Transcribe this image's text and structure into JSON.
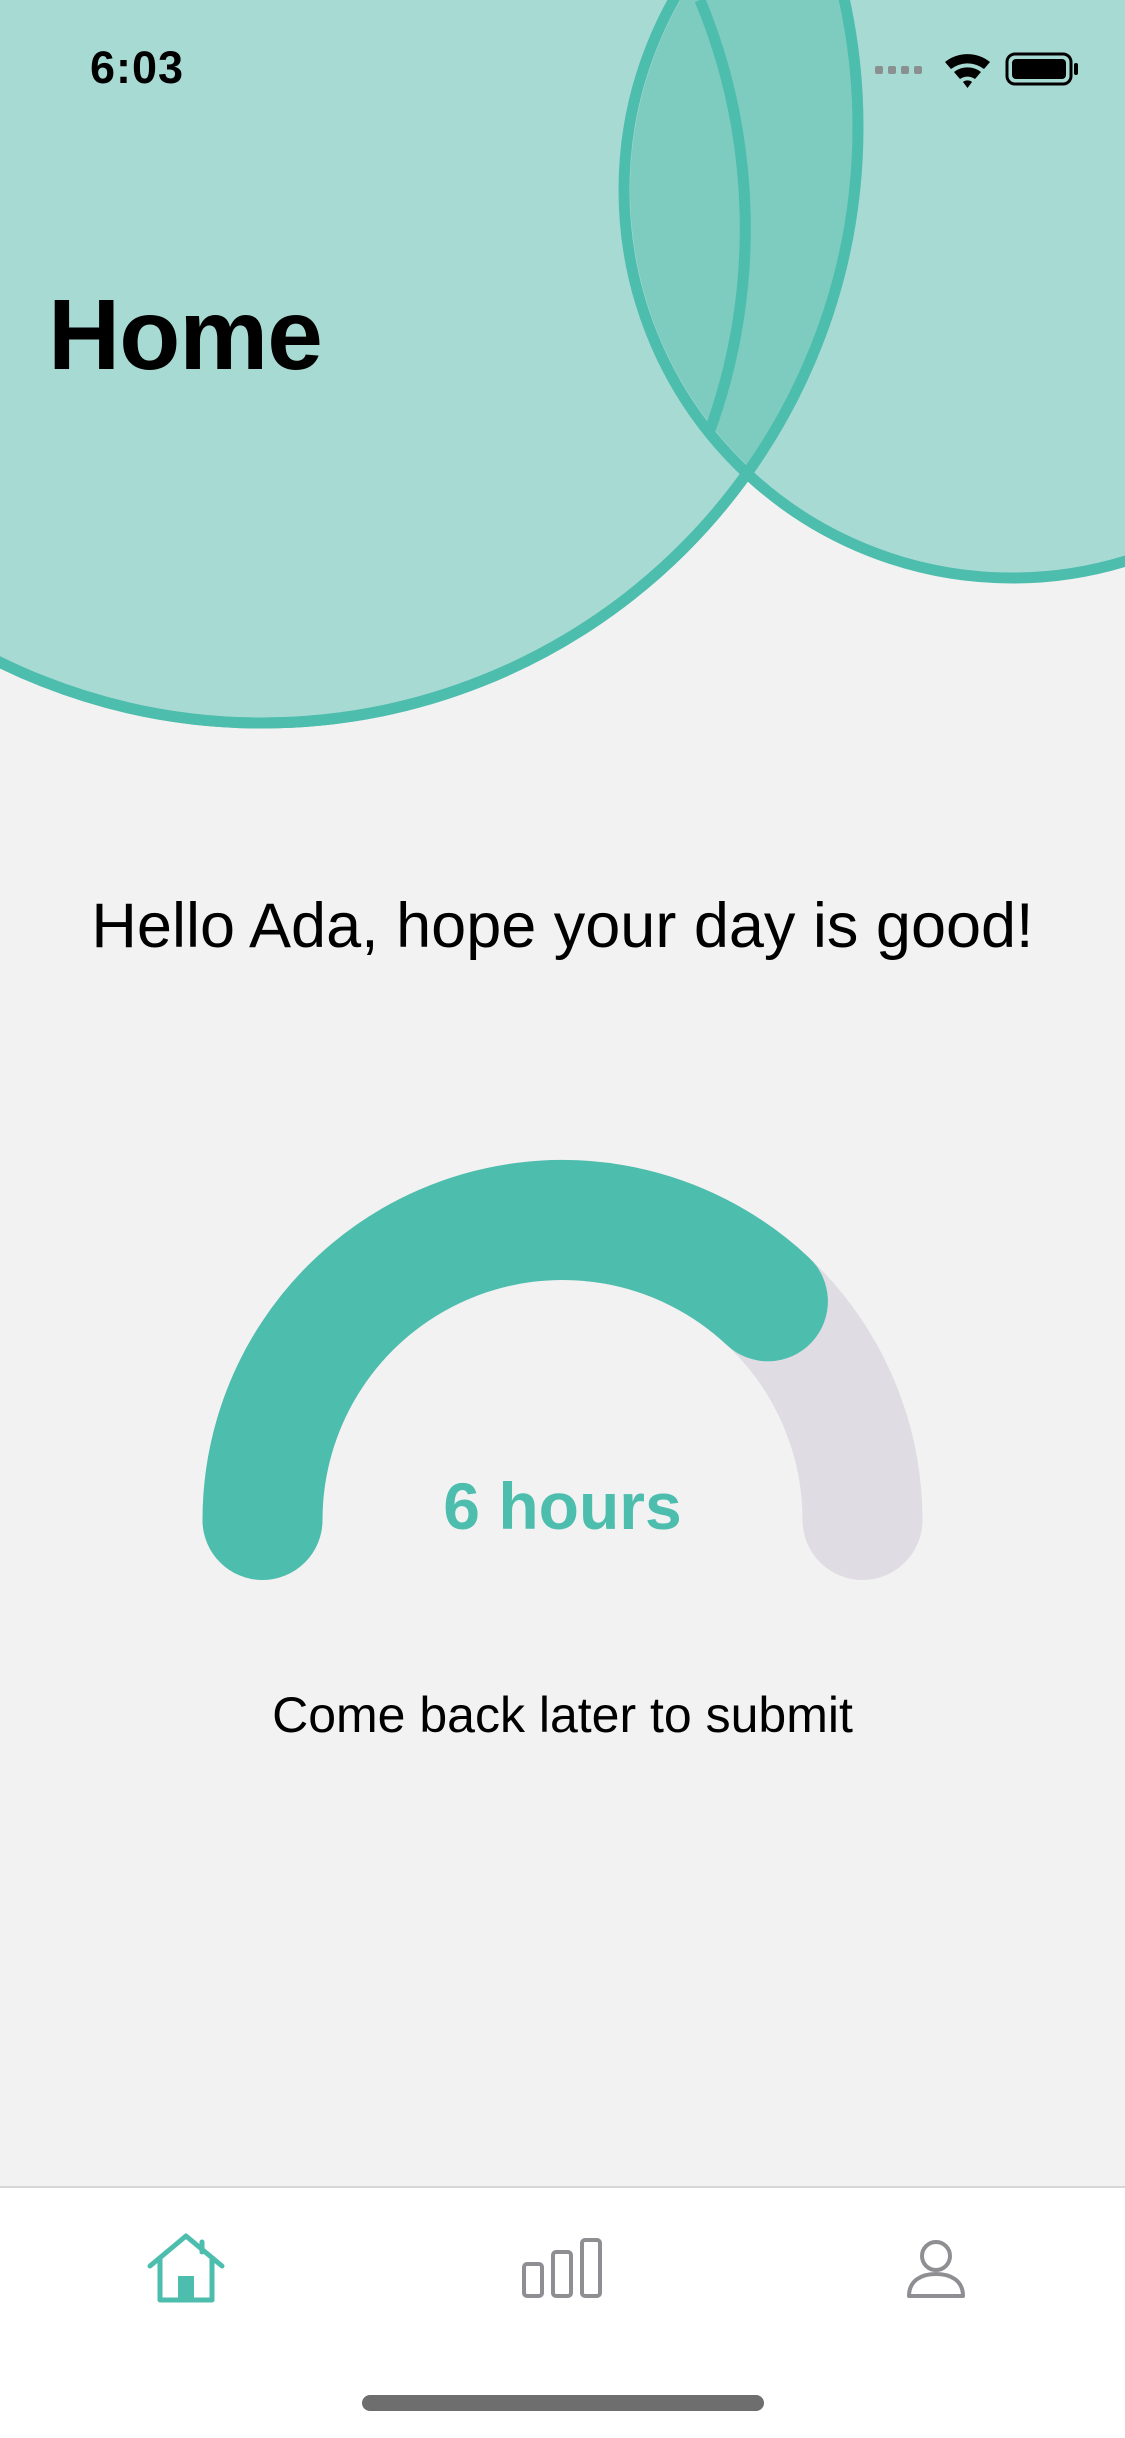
{
  "status_bar": {
    "time": "6:03"
  },
  "header": {
    "title": "Home"
  },
  "greeting": "Hello Ada, hope your day is good!",
  "progress": {
    "value_label": "6 hours",
    "fraction": 0.74,
    "caption": "Come back later to submit"
  },
  "tab_bar": {
    "items": [
      {
        "icon": "home-icon",
        "selected": true
      },
      {
        "icon": "bar-chart-icon",
        "selected": false
      },
      {
        "icon": "profile-icon",
        "selected": false
      }
    ]
  },
  "colors": {
    "accent": "#4dbdad",
    "bubble_fill": "#a8dad4",
    "bubble_overlap": "#7ecbbf",
    "track": "#dfdde3",
    "background": "#f2f2f2",
    "inactive_icon": "#8e8e93"
  }
}
